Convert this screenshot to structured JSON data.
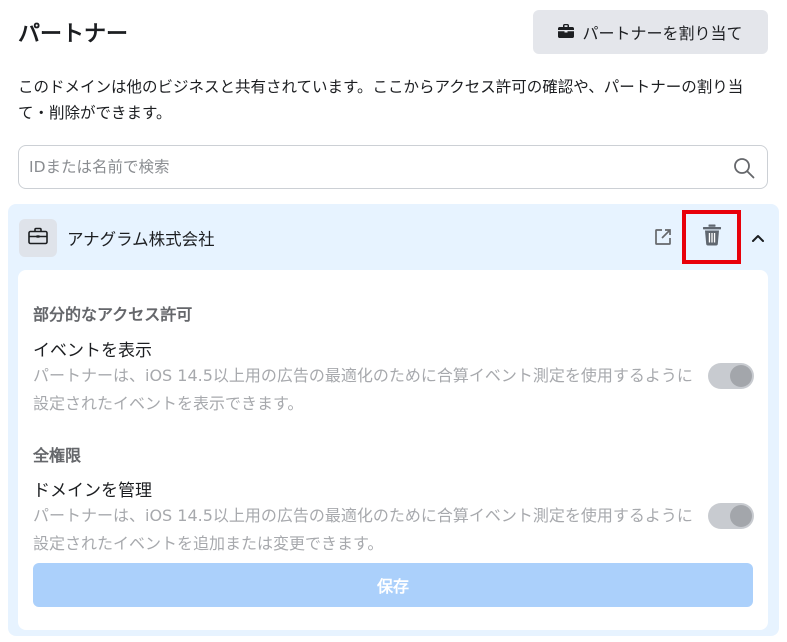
{
  "header": {
    "title": "パートナー",
    "assign_button_label": "パートナーを割り当て",
    "assign_button_icon": "briefcase-icon"
  },
  "description": "このドメインは他のビジネスと共有されています。ここからアクセス許可の確認や、パートナーの割り当て・削除ができます。",
  "search": {
    "placeholder": "IDまたは名前で検索",
    "value": "",
    "icon": "search-icon"
  },
  "partner": {
    "name": "アナグラム株式会社",
    "avatar_icon": "briefcase-icon",
    "actions": [
      "external-link-icon",
      "trash-icon",
      "chevron-up-icon"
    ],
    "highlight_color": "#e8000a",
    "sections": [
      {
        "heading": "部分的なアクセス許可",
        "permission": {
          "title": "イベントを表示",
          "description": "パートナーは、iOS 14.5以上用の広告の最適化のために合算イベント測定を使用するように設定されたイベントを表示できます。",
          "enabled": true
        }
      },
      {
        "heading": "全権限",
        "permission": {
          "title": "ドメインを管理",
          "description": "パートナーは、iOS 14.5以上用の広告の最適化のために合算イベント測定を使用するように設定されたイベントを追加または変更できます。",
          "enabled": true
        }
      }
    ],
    "save_label": "保存",
    "save_enabled": false
  },
  "colors": {
    "card_background": "#e7f3ff",
    "save_button": "#abd0fb",
    "toggle_disabled": "#c8cbd0"
  }
}
